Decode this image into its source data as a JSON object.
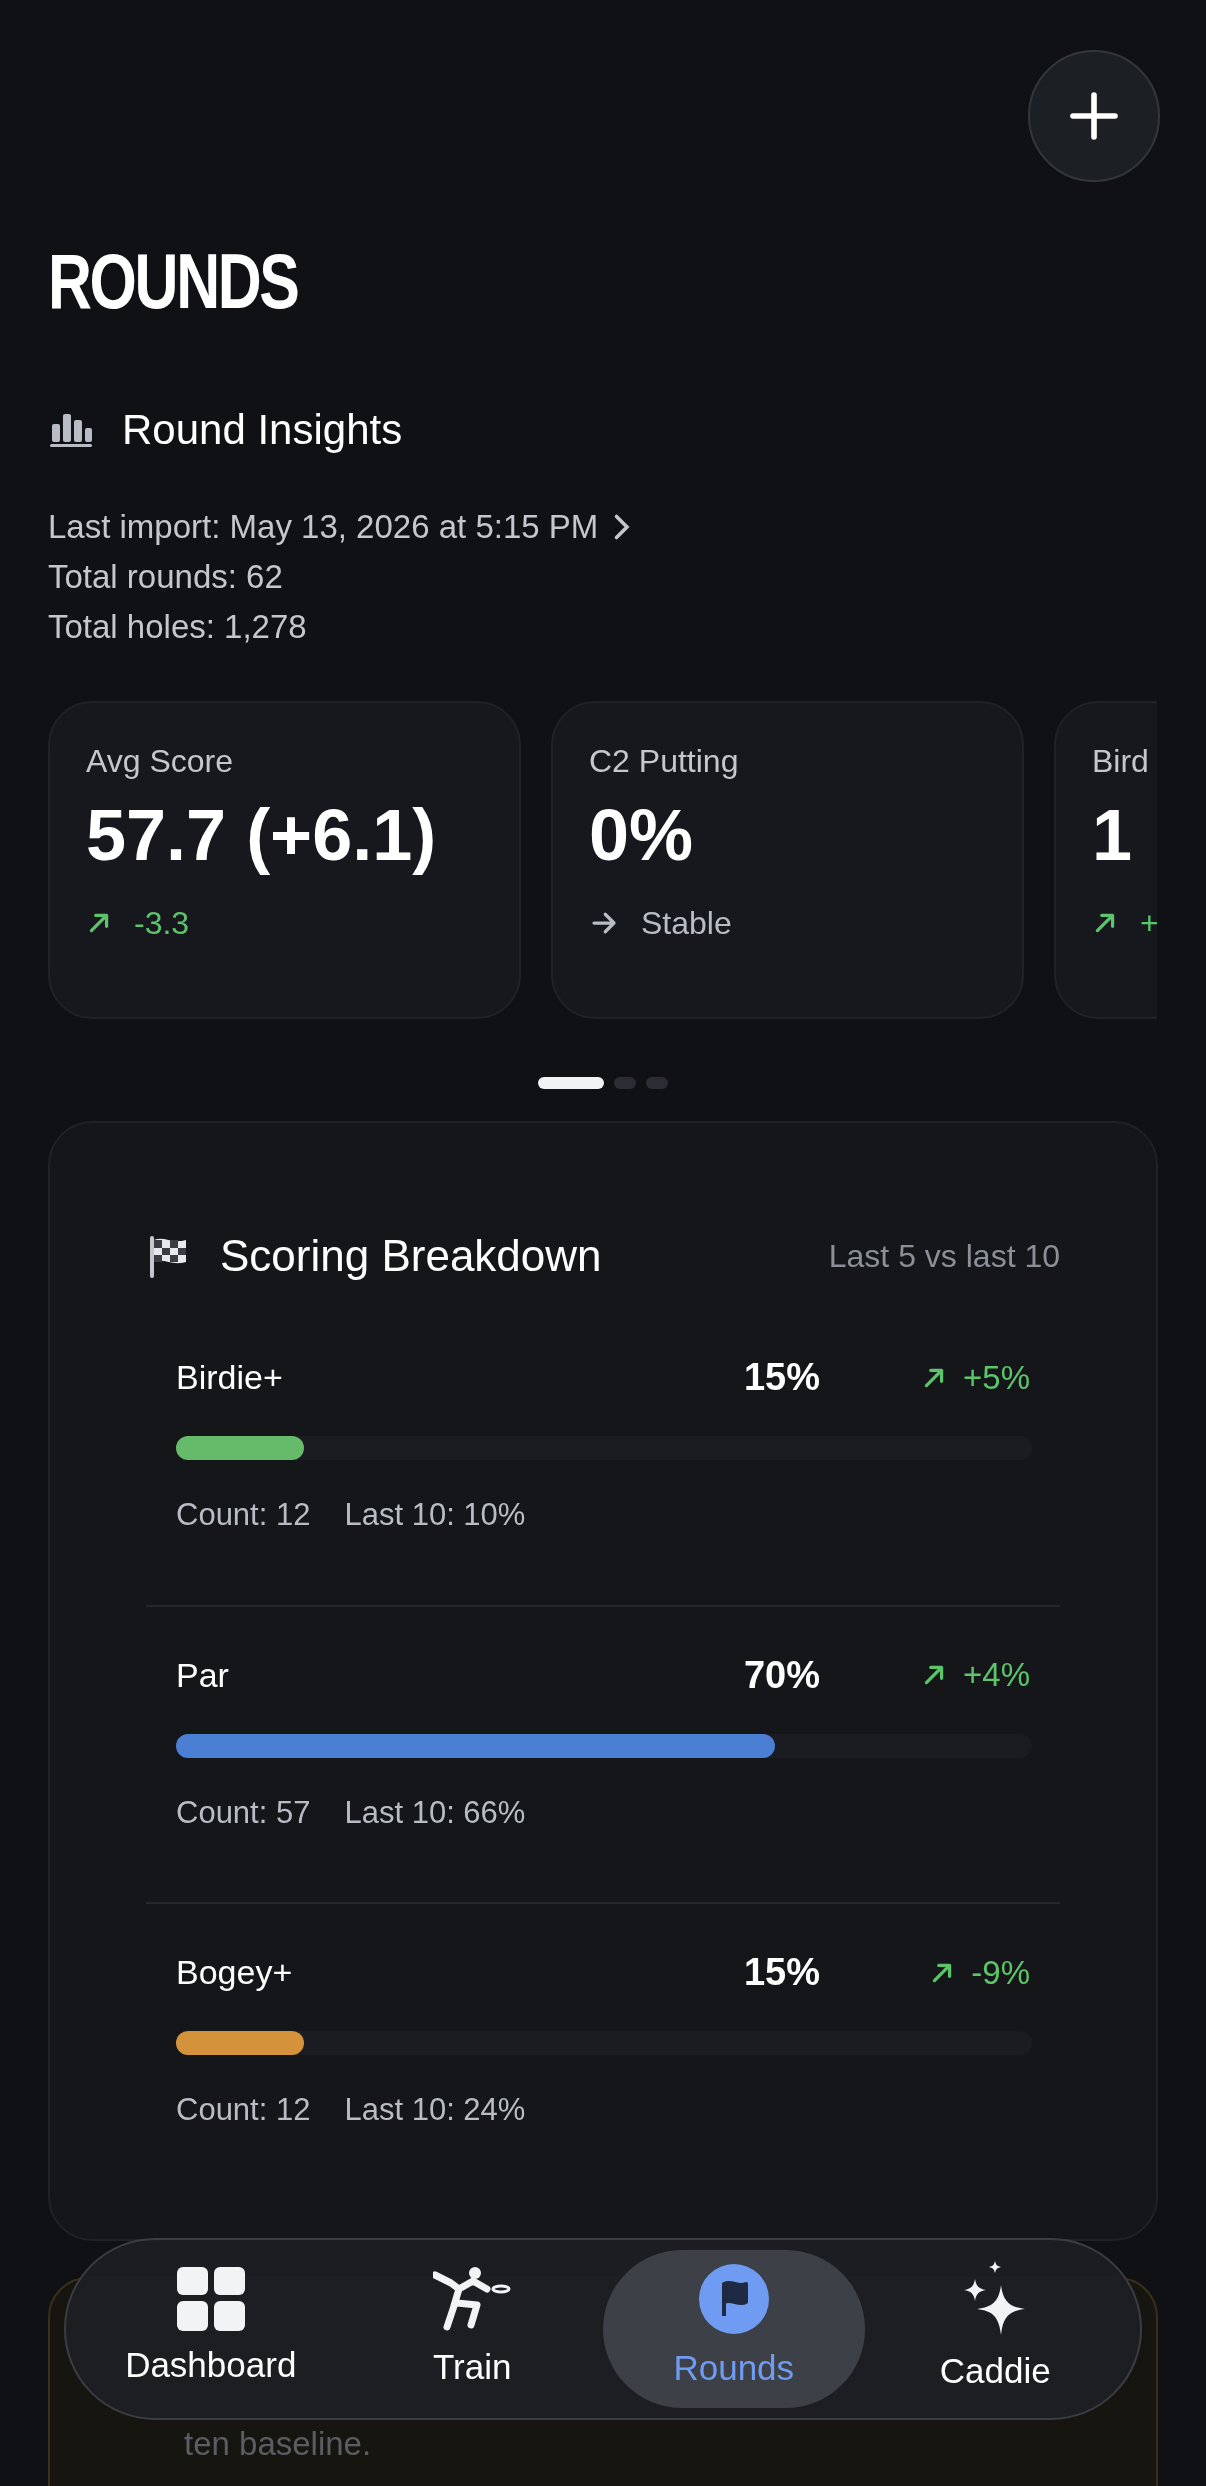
{
  "header": {
    "title": "ROUNDS"
  },
  "insights": {
    "title": "Round Insights",
    "last_import": "Last import: May 13, 2026 at 5:15 PM",
    "total_rounds": "Total rounds: 62",
    "total_holes": "Total holes: 1,278"
  },
  "stat_cards": [
    {
      "label": "Avg Score",
      "value": "57.7 (+6.1)",
      "kind": "up",
      "change": "-3.3"
    },
    {
      "label": "C2 Putting",
      "value": "0%",
      "kind": "flat",
      "change": "Stable"
    },
    {
      "label": "Bird",
      "value": "1",
      "kind": "up",
      "change": "+"
    }
  ],
  "pager": [
    {
      "selected": true
    },
    {
      "selected": false
    },
    {
      "selected": false
    }
  ],
  "breakdown": {
    "title": "Scoring Breakdown",
    "subtitle": "Last 5 vs last 10",
    "rows": [
      {
        "name": "Birdie+",
        "percent": "15%",
        "change": "+5%",
        "level": 0.15,
        "color": "#66bb6a",
        "count": "Count: 12",
        "last10": "Last 10: 10%"
      },
      {
        "name": "Par",
        "percent": "70%",
        "change": "+4%",
        "level": 0.7,
        "color": "#4a7fd4",
        "count": "Count: 57",
        "last10": "Last 10: 66%"
      },
      {
        "name": "Bogey+",
        "percent": "15%",
        "change": "-9%",
        "level": 0.15,
        "color": "#d4923a",
        "count": "Count: 12",
        "last10": "Last 10: 24%"
      }
    ]
  },
  "alert": {
    "text": "ten baseline."
  },
  "tabs": [
    {
      "kind": "dashboard",
      "label": "Dashboard",
      "selected": false
    },
    {
      "kind": "train",
      "label": "Train",
      "selected": false
    },
    {
      "kind": "rounds",
      "label": "Rounds",
      "selected": true
    },
    {
      "kind": "caddie",
      "label": "Caddie",
      "selected": false
    }
  ]
}
